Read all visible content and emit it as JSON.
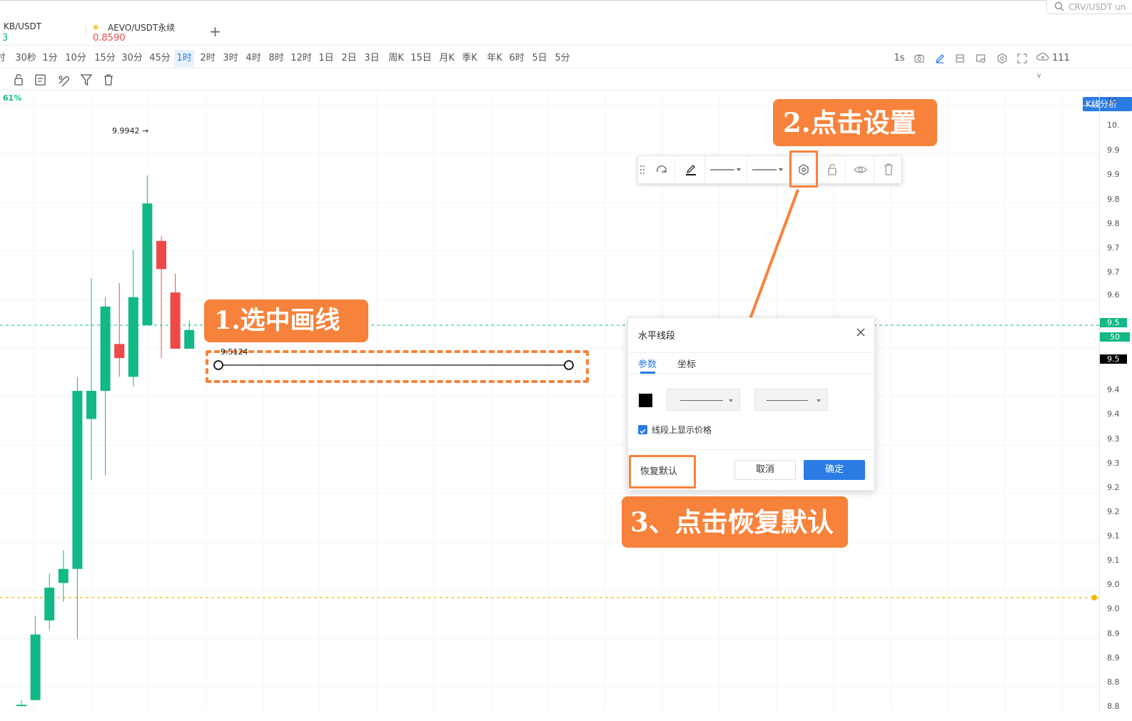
{
  "search": {
    "placeholder": "CRV/USDT un"
  },
  "symbol_tabs": [
    {
      "name": "KB/USDT",
      "price": "3",
      "price_color": "#12b886"
    },
    {
      "name": "AEVO/USDT永续",
      "price": "0.8590",
      "price_color": "#f04848"
    }
  ],
  "add_tab_label": "+",
  "intervals": [
    "时",
    "30秒",
    "1分",
    "10分",
    "15分",
    "30分",
    "45分",
    "1时",
    "2时",
    "3时",
    "4时",
    "8时",
    "12时",
    "1日",
    "2日",
    "3日",
    "周K",
    "15日",
    "月K",
    "季K",
    "年K",
    "6时",
    "5日",
    "5分"
  ],
  "active_interval": "1时",
  "right_controls": {
    "refresh": "1s",
    "cloud_count": "111",
    "analysis_button": "K线分析"
  },
  "chart": {
    "change_pct": "61%",
    "high_label": "9.9942 →",
    "selected_line_price": "9.5124",
    "y_ticks": [
      "10.",
      "10.",
      "9.9",
      "9.9",
      "9.8",
      "9.8",
      "9.7",
      "9.7",
      "9.6",
      "9.5",
      "50",
      "9.5",
      "9.4",
      "9.4",
      "9.3",
      "9.3",
      "9.2",
      "9.2",
      "9.1",
      "9.1",
      "9.0",
      "9.0",
      "8.9",
      "8.9",
      "8.8",
      "8.8"
    ],
    "candles": [
      {
        "o": 8.77,
        "c": 8.77,
        "h": 8.78,
        "l": 8.77
      },
      {
        "o": 8.78,
        "c": 8.92,
        "h": 8.96,
        "l": 8.78
      },
      {
        "o": 8.95,
        "c": 9.02,
        "h": 9.05,
        "l": 8.93
      },
      {
        "o": 9.03,
        "c": 9.06,
        "h": 9.1,
        "l": 8.99
      },
      {
        "o": 9.06,
        "c": 9.44,
        "h": 9.47,
        "l": 8.91
      },
      {
        "o": 9.38,
        "c": 9.44,
        "h": 9.68,
        "l": 9.25
      },
      {
        "o": 9.44,
        "c": 9.62,
        "h": 9.64,
        "l": 9.26
      },
      {
        "o": 9.54,
        "c": 9.51,
        "h": 9.67,
        "l": 9.47
      },
      {
        "o": 9.47,
        "c": 9.64,
        "h": 9.74,
        "l": 9.45
      },
      {
        "o": 9.58,
        "c": 9.84,
        "h": 9.9,
        "l": 9.58
      },
      {
        "o": 9.76,
        "c": 9.7,
        "h": 9.77,
        "l": 9.51
      },
      {
        "o": 9.65,
        "c": 9.53,
        "h": 9.69,
        "l": 9.53
      },
      {
        "o": 9.53,
        "c": 9.57,
        "h": 9.59,
        "l": 9.53
      }
    ]
  },
  "floating_toolbar": {
    "line_style_1": "——",
    "line_style_2": "——"
  },
  "dialog": {
    "title": "水平线段",
    "tabs": [
      "参数",
      "坐标"
    ],
    "checkbox_label": "线段上显示价格",
    "reset_button": "恢复默认",
    "cancel_button": "取消",
    "confirm_button": "确定"
  },
  "annotations": {
    "step1": "1.选中画线",
    "step2": "2.点击设置",
    "step3": "3、点击恢复默认"
  },
  "colors": {
    "up": "#12b886",
    "down": "#f04848",
    "accent": "#2a7be4",
    "callout": "#f7823b"
  }
}
